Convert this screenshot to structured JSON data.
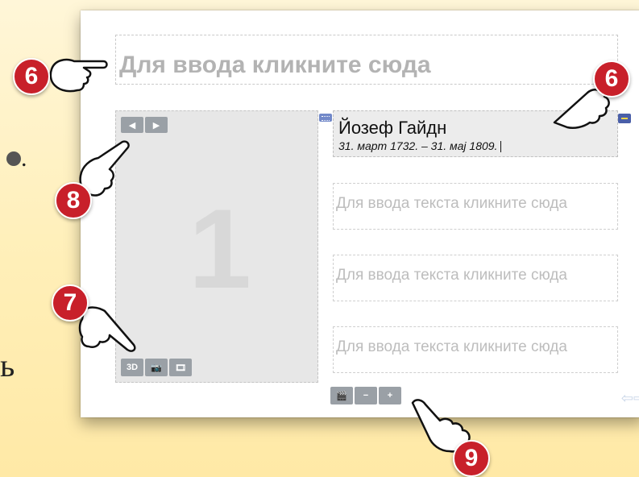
{
  "background_fragments": {
    "frag1": ".",
    "frag2": "ь"
  },
  "title_field": {
    "placeholder": "Для ввода кликните сюда"
  },
  "media_panel": {
    "slide_number": "1",
    "nav": {
      "prev": "◀",
      "next": "▶"
    },
    "tools": {
      "btn_3d": "3D",
      "btn_photo": "📷",
      "btn_film": "🎞"
    }
  },
  "text_column": {
    "active_box": {
      "name": "Йозеф Гайдн",
      "dates": "31. март 1732. – 31. мај 1809."
    },
    "placeholders": [
      "Для ввода текста кликните сюда",
      "Для ввода текста кликните сюда",
      "Для ввода текста кликните сюда"
    ],
    "tools": {
      "clapper": "🎬",
      "minus": "−",
      "plus": "+"
    }
  },
  "callouts": {
    "c6_left": "6",
    "c6_right": "6",
    "c8": "8",
    "c7": "7",
    "c9": "9"
  },
  "colors": {
    "callout": "#c8202a",
    "tool_button": "#9aa0a6",
    "placeholder_text": "#b3b3b3",
    "panel_gray": "#e7e7e7"
  },
  "icons": [
    "keyboard-icon",
    "minimize-icon",
    "hand-pointer-icon",
    "left-arrow-icon",
    "right-arrow-icon"
  ]
}
